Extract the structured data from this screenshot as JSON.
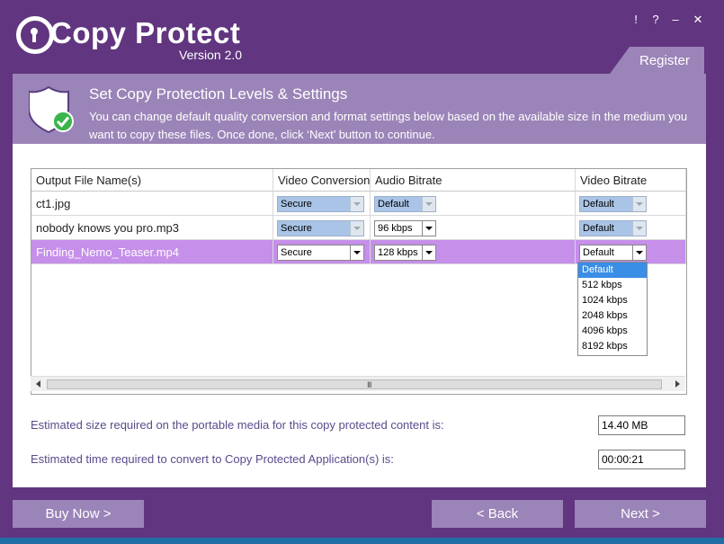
{
  "app": {
    "title": "Copy Protect",
    "version": "Version 2.0"
  },
  "window_controls": {
    "help": "!",
    "about": "?",
    "minimize": "–",
    "close": "✕"
  },
  "register_label": "Register",
  "info": {
    "title": "Set Copy Protection Levels & Settings",
    "description": "You can change default quality conversion and format settings below based on the available size in the medium you want to copy these files. Once done, click ‘Next’ button to continue."
  },
  "grid": {
    "columns": [
      "Output File Name(s)",
      "Video Conversion",
      "Audio Bitrate",
      "Video Bitrate"
    ],
    "rows": [
      {
        "name": "ct1.jpg",
        "video_conversion": "Secure",
        "audio_bitrate": "Default",
        "video_bitrate": "Default"
      },
      {
        "name": "nobody knows you pro.mp3",
        "video_conversion": "Secure",
        "audio_bitrate": "96 kbps",
        "video_bitrate": "Default"
      },
      {
        "name": "Finding_Nemo_Teaser.mp4",
        "video_conversion": "Secure",
        "audio_bitrate": "128 kbps",
        "video_bitrate": "Default"
      }
    ],
    "selected_row": 2,
    "video_bitrate_options": [
      "Default",
      "512 kbps",
      "1024 kbps",
      "2048 kbps",
      "4096 kbps",
      "8192 kbps"
    ],
    "scroll_grip": "III"
  },
  "estimates": {
    "size_label": "Estimated size required on the portable media for this copy protected content is:",
    "size_value": "14.40 MB",
    "time_label": "Estimated time required to convert to Copy Protected Application(s) is:",
    "time_value": "00:00:21"
  },
  "buttons": {
    "buy_now": "Buy Now >",
    "back": "< Back",
    "next": "Next >"
  },
  "colors": {
    "background": "#61357f",
    "band": "#9b84b8",
    "selected_row": "#c58fea",
    "dropdown_highlight": "#3b8ee6"
  }
}
